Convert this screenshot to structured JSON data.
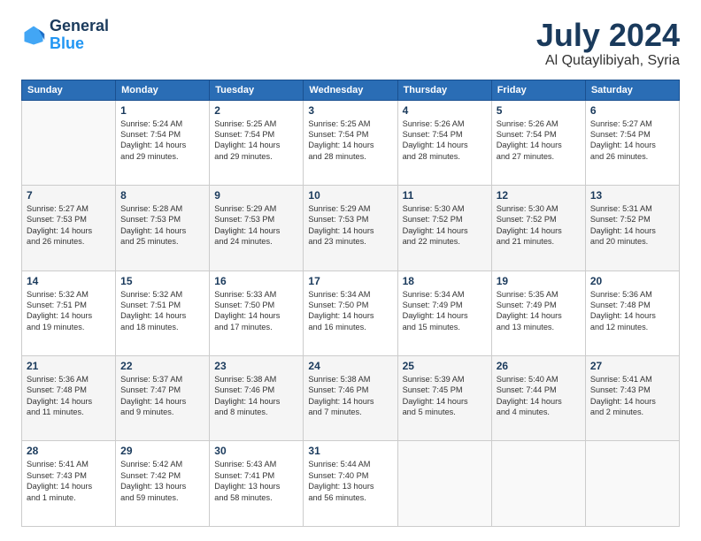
{
  "header": {
    "logo_line1": "General",
    "logo_line2": "Blue",
    "main_title": "July 2024",
    "sub_title": "Al Qutaylibiyah, Syria"
  },
  "columns": [
    "Sunday",
    "Monday",
    "Tuesday",
    "Wednesday",
    "Thursday",
    "Friday",
    "Saturday"
  ],
  "weeks": [
    [
      {
        "day": "",
        "info": ""
      },
      {
        "day": "1",
        "info": "Sunrise: 5:24 AM\nSunset: 7:54 PM\nDaylight: 14 hours\nand 29 minutes."
      },
      {
        "day": "2",
        "info": "Sunrise: 5:25 AM\nSunset: 7:54 PM\nDaylight: 14 hours\nand 29 minutes."
      },
      {
        "day": "3",
        "info": "Sunrise: 5:25 AM\nSunset: 7:54 PM\nDaylight: 14 hours\nand 28 minutes."
      },
      {
        "day": "4",
        "info": "Sunrise: 5:26 AM\nSunset: 7:54 PM\nDaylight: 14 hours\nand 28 minutes."
      },
      {
        "day": "5",
        "info": "Sunrise: 5:26 AM\nSunset: 7:54 PM\nDaylight: 14 hours\nand 27 minutes."
      },
      {
        "day": "6",
        "info": "Sunrise: 5:27 AM\nSunset: 7:54 PM\nDaylight: 14 hours\nand 26 minutes."
      }
    ],
    [
      {
        "day": "7",
        "info": "Sunrise: 5:27 AM\nSunset: 7:53 PM\nDaylight: 14 hours\nand 26 minutes."
      },
      {
        "day": "8",
        "info": "Sunrise: 5:28 AM\nSunset: 7:53 PM\nDaylight: 14 hours\nand 25 minutes."
      },
      {
        "day": "9",
        "info": "Sunrise: 5:29 AM\nSunset: 7:53 PM\nDaylight: 14 hours\nand 24 minutes."
      },
      {
        "day": "10",
        "info": "Sunrise: 5:29 AM\nSunset: 7:53 PM\nDaylight: 14 hours\nand 23 minutes."
      },
      {
        "day": "11",
        "info": "Sunrise: 5:30 AM\nSunset: 7:52 PM\nDaylight: 14 hours\nand 22 minutes."
      },
      {
        "day": "12",
        "info": "Sunrise: 5:30 AM\nSunset: 7:52 PM\nDaylight: 14 hours\nand 21 minutes."
      },
      {
        "day": "13",
        "info": "Sunrise: 5:31 AM\nSunset: 7:52 PM\nDaylight: 14 hours\nand 20 minutes."
      }
    ],
    [
      {
        "day": "14",
        "info": "Sunrise: 5:32 AM\nSunset: 7:51 PM\nDaylight: 14 hours\nand 19 minutes."
      },
      {
        "day": "15",
        "info": "Sunrise: 5:32 AM\nSunset: 7:51 PM\nDaylight: 14 hours\nand 18 minutes."
      },
      {
        "day": "16",
        "info": "Sunrise: 5:33 AM\nSunset: 7:50 PM\nDaylight: 14 hours\nand 17 minutes."
      },
      {
        "day": "17",
        "info": "Sunrise: 5:34 AM\nSunset: 7:50 PM\nDaylight: 14 hours\nand 16 minutes."
      },
      {
        "day": "18",
        "info": "Sunrise: 5:34 AM\nSunset: 7:49 PM\nDaylight: 14 hours\nand 15 minutes."
      },
      {
        "day": "19",
        "info": "Sunrise: 5:35 AM\nSunset: 7:49 PM\nDaylight: 14 hours\nand 13 minutes."
      },
      {
        "day": "20",
        "info": "Sunrise: 5:36 AM\nSunset: 7:48 PM\nDaylight: 14 hours\nand 12 minutes."
      }
    ],
    [
      {
        "day": "21",
        "info": "Sunrise: 5:36 AM\nSunset: 7:48 PM\nDaylight: 14 hours\nand 11 minutes."
      },
      {
        "day": "22",
        "info": "Sunrise: 5:37 AM\nSunset: 7:47 PM\nDaylight: 14 hours\nand 9 minutes."
      },
      {
        "day": "23",
        "info": "Sunrise: 5:38 AM\nSunset: 7:46 PM\nDaylight: 14 hours\nand 8 minutes."
      },
      {
        "day": "24",
        "info": "Sunrise: 5:38 AM\nSunset: 7:46 PM\nDaylight: 14 hours\nand 7 minutes."
      },
      {
        "day": "25",
        "info": "Sunrise: 5:39 AM\nSunset: 7:45 PM\nDaylight: 14 hours\nand 5 minutes."
      },
      {
        "day": "26",
        "info": "Sunrise: 5:40 AM\nSunset: 7:44 PM\nDaylight: 14 hours\nand 4 minutes."
      },
      {
        "day": "27",
        "info": "Sunrise: 5:41 AM\nSunset: 7:43 PM\nDaylight: 14 hours\nand 2 minutes."
      }
    ],
    [
      {
        "day": "28",
        "info": "Sunrise: 5:41 AM\nSunset: 7:43 PM\nDaylight: 14 hours\nand 1 minute."
      },
      {
        "day": "29",
        "info": "Sunrise: 5:42 AM\nSunset: 7:42 PM\nDaylight: 13 hours\nand 59 minutes."
      },
      {
        "day": "30",
        "info": "Sunrise: 5:43 AM\nSunset: 7:41 PM\nDaylight: 13 hours\nand 58 minutes."
      },
      {
        "day": "31",
        "info": "Sunrise: 5:44 AM\nSunset: 7:40 PM\nDaylight: 13 hours\nand 56 minutes."
      },
      {
        "day": "",
        "info": ""
      },
      {
        "day": "",
        "info": ""
      },
      {
        "day": "",
        "info": ""
      }
    ]
  ]
}
